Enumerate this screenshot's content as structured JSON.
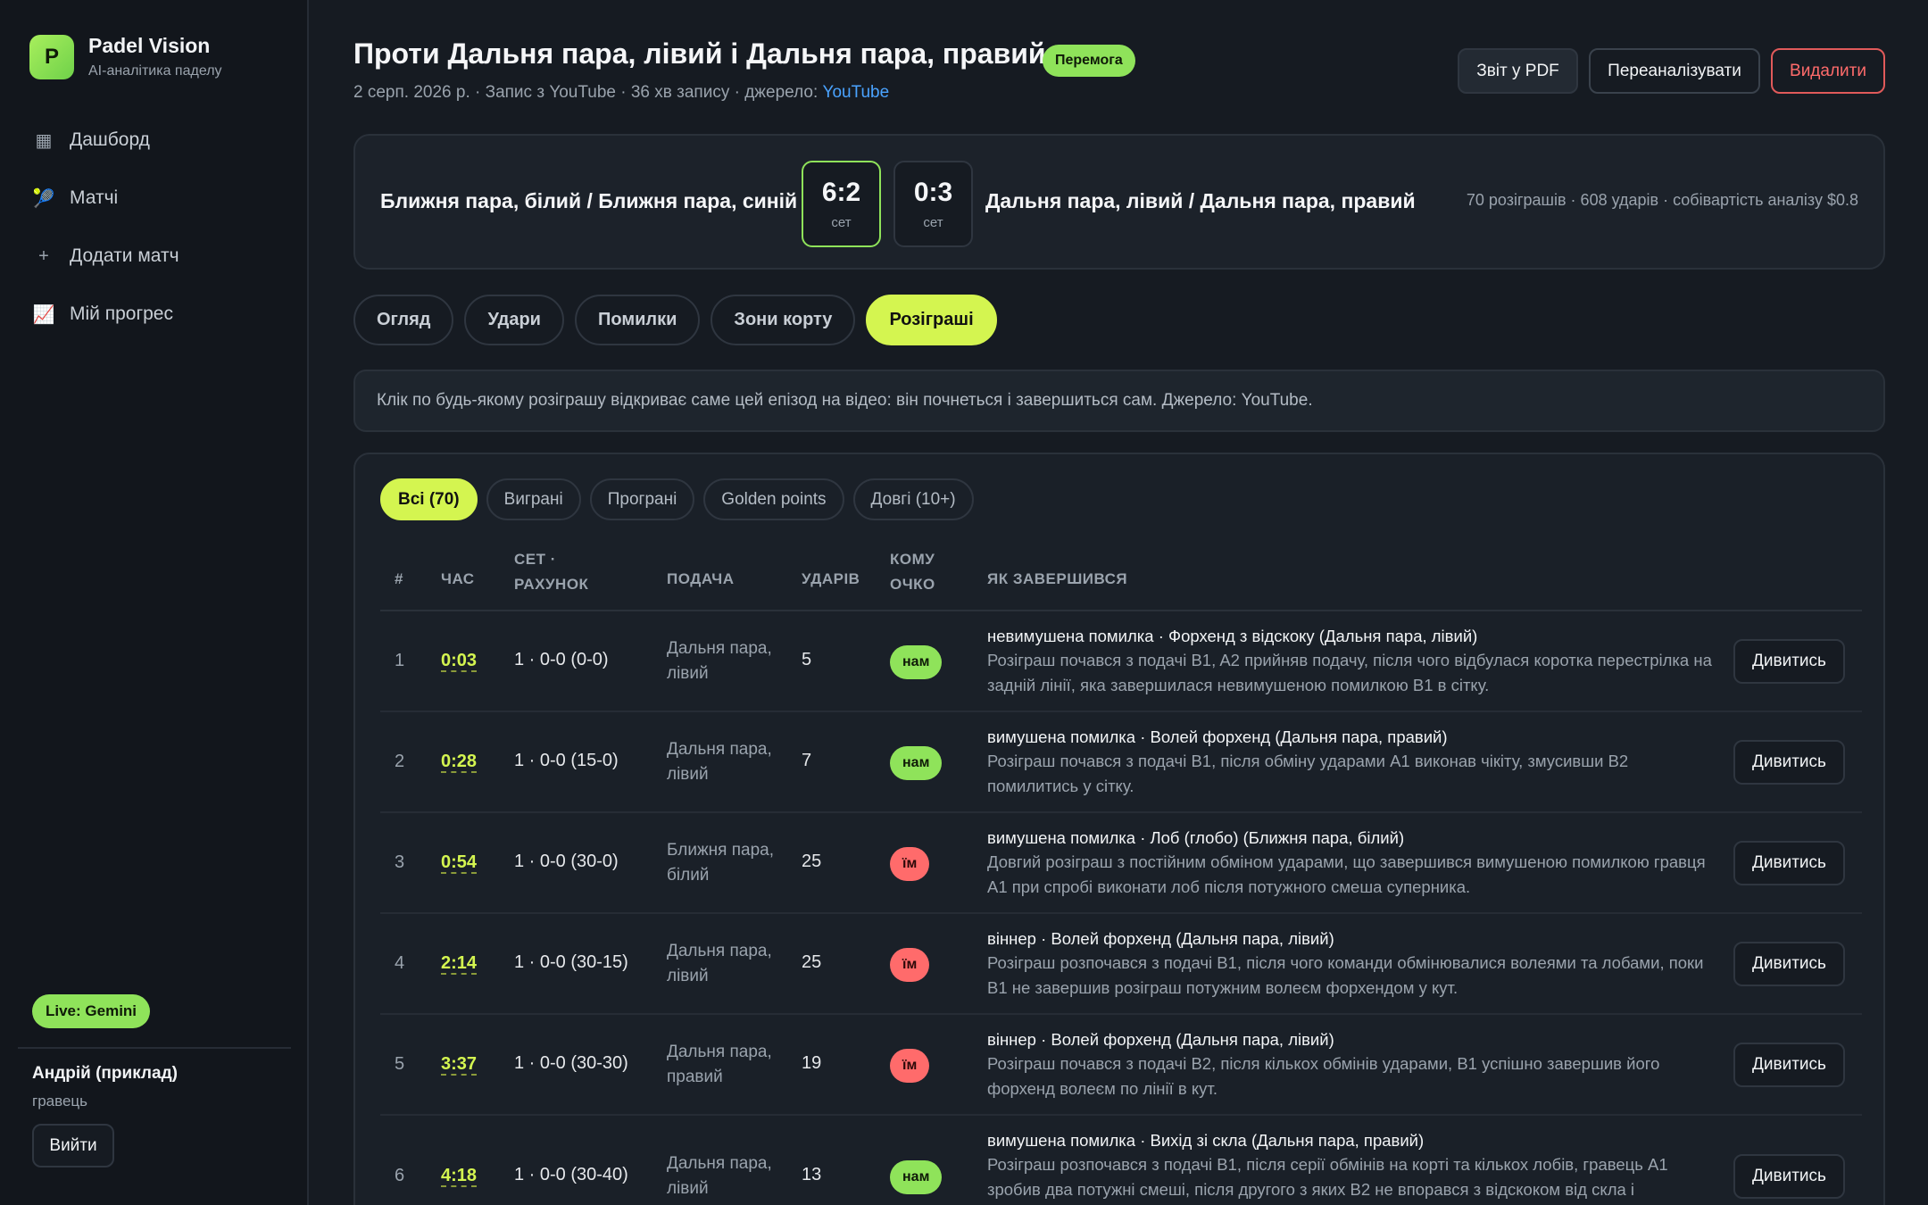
{
  "app": {
    "name": "Padel Vision",
    "subtitle": "AI-аналітика паделу",
    "logo_letter": "P"
  },
  "nav": [
    {
      "icon": "grid-icon",
      "glyph": "▦",
      "label": "Дашборд"
    },
    {
      "icon": "racket-icon",
      "glyph": "🎾",
      "label": "Матчі"
    },
    {
      "icon": "plus-icon",
      "glyph": "+",
      "label": "Додати матч"
    },
    {
      "icon": "chart-icon",
      "glyph": "📈",
      "label": "Мій прогрес"
    }
  ],
  "live_badge": "Live: Gemini",
  "user": {
    "name": "Андрій (приклад)",
    "role": "гравець",
    "logout": "Вийти"
  },
  "header": {
    "title": "Проти Дальня пара, лівий і Дальня пара, правий",
    "result_badge": "Перемога",
    "meta_prefix": "2 серп. 2026 р. · Запис з YouTube · 36 хв запису · джерело:",
    "meta_link": "YouTube",
    "buttons": {
      "pdf": "Звіт у PDF",
      "reanalyze": "Переаналізувати",
      "delete": "Видалити"
    }
  },
  "score": {
    "team_a": "Ближня пара, білий / Ближня пара, синій",
    "team_b": "Дальня пара, лівий / Дальня пара, правий",
    "sets": [
      {
        "value": "6:2",
        "label": "сет"
      },
      {
        "value": "0:3",
        "label": "сет"
      }
    ],
    "stats": "70 розіграшів · 608 ударів · собівартість аналізу $0.8"
  },
  "tabs": [
    "Огляд",
    "Удари",
    "Помилки",
    "Зони корту",
    "Розіграші"
  ],
  "active_tab": "Розіграші",
  "info_text": "Клік по будь-якому розіграшу відкриває саме цей епізод на відео: він почнеться і завершиться сам. Джерело: YouTube.",
  "filters": [
    "Всі (70)",
    "Виграні",
    "Програні",
    "Golden points",
    "Довгі (10+)"
  ],
  "table": {
    "headers": {
      "num": "#",
      "time": "ЧАС",
      "set_line1": "СЕТ ·",
      "set_line2": "РАХУНОК",
      "serve": "ПОДАЧА",
      "strokes": "УДАРІВ",
      "who_line1": "КОМУ",
      "who_line2": "ОЧКО",
      "how": "ЯК ЗАВЕРШИВСЯ"
    },
    "watch_label": "Дивитись",
    "rows": [
      {
        "num": "1",
        "time": "0:03",
        "set": "1 · 0-0 (0-0)",
        "serve": "Дальня пара, лівий",
        "strokes": "5",
        "who": "нам",
        "who_type": "us",
        "how_title": "невимушена помилка · Форхенд з відскоку (Дальня пара, лівий)",
        "how_desc": "Розіграш почався з подачі B1, A2 прийняв подачу, після чого відбулася коротка перестрілка на задній лінії, яка завершилася невимушеною помилкою B1 в сітку."
      },
      {
        "num": "2",
        "time": "0:28",
        "set": "1 · 0-0 (15-0)",
        "serve": "Дальня пара, лівий",
        "strokes": "7",
        "who": "нам",
        "who_type": "us",
        "how_title": "вимушена помилка · Волей форхенд (Дальня пара, правий)",
        "how_desc": "Розіграш почався з подачі B1, після обміну ударами A1 виконав чікіту, змусивши B2 помилитись у сітку."
      },
      {
        "num": "3",
        "time": "0:54",
        "set": "1 · 0-0 (30-0)",
        "serve": "Ближня пара, білий",
        "strokes": "25",
        "who": "їм",
        "who_type": "them",
        "how_title": "вимушена помилка · Лоб (глобо) (Ближня пара, білий)",
        "how_desc": "Довгий розіграш з постійним обміном ударами, що завершився вимушеною помилкою гравця A1 при спробі виконати лоб після потужного смеша суперника."
      },
      {
        "num": "4",
        "time": "2:14",
        "set": "1 · 0-0 (30-15)",
        "serve": "Дальня пара, лівий",
        "strokes": "25",
        "who": "їм",
        "who_type": "them",
        "how_title": "віннер · Волей форхенд (Дальня пара, лівий)",
        "how_desc": "Розіграш розпочався з подачі B1, після чого команди обмінювалися волеями та лобами, поки B1 не завершив розіграш потужним волеєм форхендом у кут."
      },
      {
        "num": "5",
        "time": "3:37",
        "set": "1 · 0-0 (30-30)",
        "serve": "Дальня пара, правий",
        "strokes": "19",
        "who": "їм",
        "who_type": "them",
        "how_title": "віннер · Волей форхенд (Дальня пара, лівий)",
        "how_desc": "Розіграш почався з подачі B2, після кількох обмінів ударами, B1 успішно завершив його форхенд волеєм по лінії в кут."
      },
      {
        "num": "6",
        "time": "4:18",
        "set": "1 · 0-0 (30-40)",
        "serve": "Дальня пара, лівий",
        "strokes": "13",
        "who": "нам",
        "who_type": "us",
        "how_title": "вимушена помилка · Вихід зі скла (Дальня пара, правий)",
        "how_desc": "Розіграш розпочався з подачі B1, після серії обмінів на корті та кількох лобів, гравець A1 зробив два потужні смеші, після другого з яких B2 не впорався з відскоком від скла і"
      }
    ]
  }
}
